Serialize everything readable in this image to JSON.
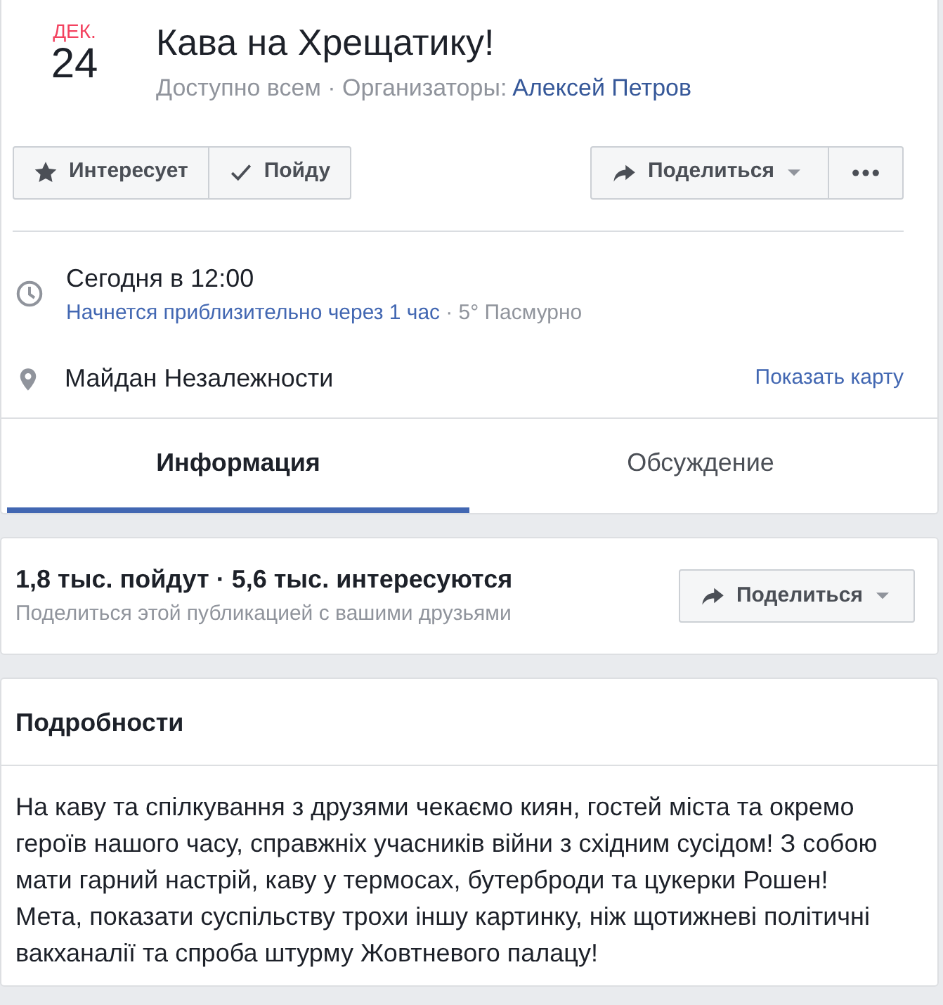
{
  "event": {
    "month": "ДЕК.",
    "day": "24",
    "title": "Кава на Хрещатику!",
    "subtitle": "Доступно всем · Организаторы:",
    "organizer": "Алексей Петров"
  },
  "actions": [
    {
      "kind": "star",
      "label": "Интересует"
    },
    {
      "kind": "check",
      "label": "Пойду"
    }
  ],
  "share_button": {
    "label": "Поделиться"
  },
  "time": {
    "main": "Сегодня в 12:00",
    "countdown": "Начнется приблизительно через 1 час",
    "weather": "· 5° Пасмурно"
  },
  "location": {
    "name": "Майдан Незалежности",
    "map_link": "Показать карту"
  },
  "tabs": [
    {
      "label": "Информация",
      "selected": true
    },
    {
      "label": "Обсуждение",
      "selected": false
    }
  ],
  "stats": {
    "summary": "1,8 тыс. пойдут · 5,6 тыс. интересуются",
    "hint": "Поделиться этой публикацией с вашими друзьями",
    "share_label": "Поделиться"
  },
  "details": {
    "heading": "Подробности",
    "paragraphs": [
      "На каву та спілкування з друзями чекаємо киян, гостей міста та окремо героїв нашого часу, справжніх учасників війни з східним сусідом! З собою мати гарний настрій, каву у термосах, бутерброди та цукерки Рошен!",
      "Мета, показати суспільству трохи іншу картинку, ніж щотижневі політичні вакханалії та спроба штурму Жовтневого палацу!"
    ]
  }
}
